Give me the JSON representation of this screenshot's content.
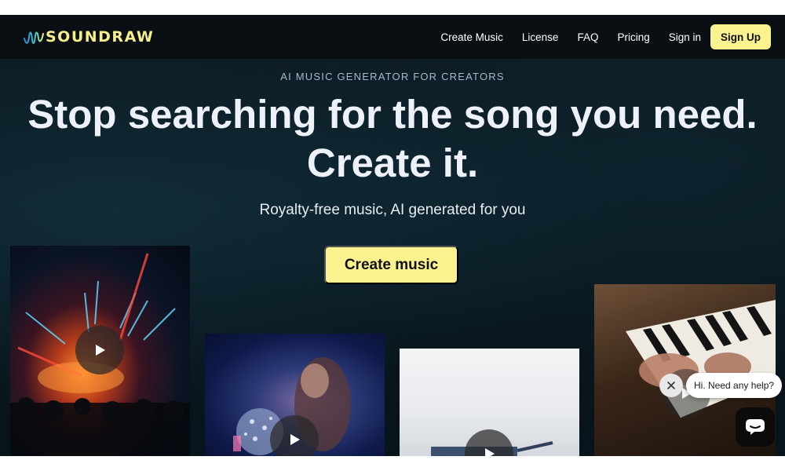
{
  "header": {
    "logo_text": "SOUNDRAW",
    "nav": [
      "Create Music",
      "License",
      "FAQ",
      "Pricing",
      "Sign in"
    ],
    "signup_label": "Sign Up"
  },
  "hero": {
    "eyebrow": "AI MUSIC GENERATOR FOR CREATORS",
    "headline_line1": "Stop searching for the song you need.",
    "headline_line2": "Create it.",
    "subheadline": "Royalty-free music, AI generated for you",
    "cta_label": "Create music"
  },
  "media_cards": [
    {
      "name": "concert",
      "icon": "play-icon"
    },
    {
      "name": "disco-ball",
      "icon": "play-icon"
    },
    {
      "name": "dancer",
      "icon": "play-icon"
    },
    {
      "name": "piano",
      "icon": "play-icon"
    }
  ],
  "chat": {
    "message": "Hi. Need any help?",
    "close_icon": "close-icon",
    "launcher_icon": "chat-icon"
  },
  "colors": {
    "accent": "#f9f28e",
    "background": "#0a1820",
    "header": "#0a0f14"
  }
}
